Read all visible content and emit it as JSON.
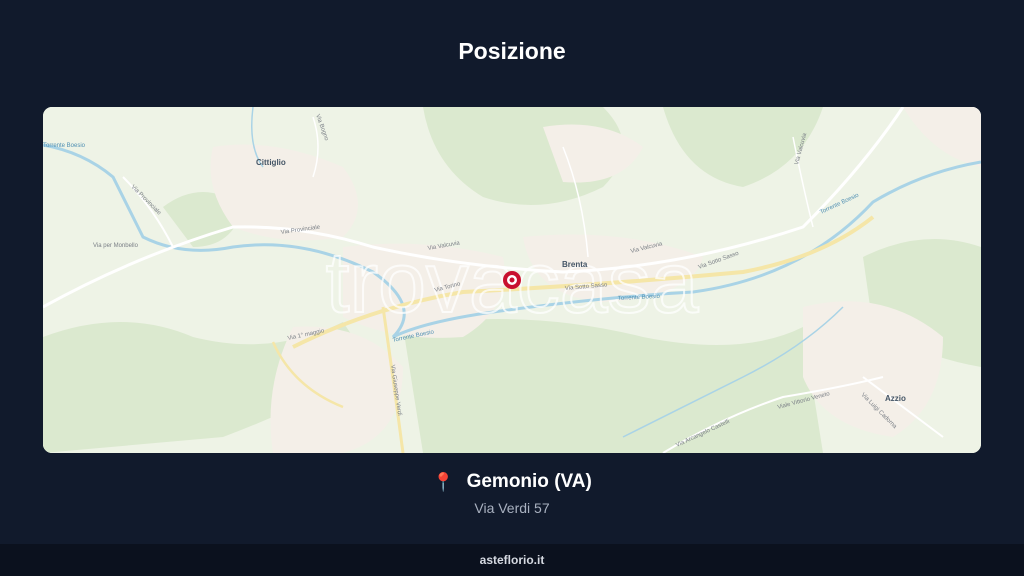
{
  "header": {
    "title": "Posizione"
  },
  "map": {
    "watermark": "trovacasa",
    "labels": {
      "cittiglio": "Cittiglio",
      "brenta": "Brenta",
      "azzio": "Azzio",
      "via_provinciale_1": "Via Provinciale",
      "via_provinciale_2": "Via Provinciale",
      "via_per_monbello": "Via per Monbello",
      "via_valcuvia_1": "Via Valcuvia",
      "via_valcuvia_2": "Via Valcuvia",
      "via_valcuvia_3": "Via Valcuvia",
      "via_torino": "Via Torino",
      "via_sotto_sasso_1": "Via Sotto Sasso",
      "via_sotto_sasso_2": "Via Sotto Sasso",
      "via_primo_maggio": "Via 1° maggio",
      "via_giuseppe_verdi": "Via Giuseppe Verdi",
      "via_arcangelo_castelli": "Via Arcangelo Castelli",
      "viale_vittorio_veneto": "Viale Vittorio Veneto",
      "via_luigi_cadorna": "Via Luigi Cadorna",
      "torrente_boesio_1": "Torrente Boesio",
      "torrente_boesio_2": "Torrente Boesio",
      "torrente_boesio_3": "Torrente Boesio",
      "torrente_boesio_4": "Torrente Boesio",
      "via_bogno": "Via Bogno",
      "via_sotto_sasso_3": "Via Sotto Sasso"
    },
    "marker": "map-pin"
  },
  "location": {
    "pin_icon": "📍",
    "city": "Gemonio (VA)",
    "address": "Via Verdi 57"
  },
  "footer": {
    "brand": "asteflorio.it"
  },
  "colors": {
    "background": "#111a2c",
    "footer": "#0b111e",
    "marker": "#c8102e",
    "river": "#a9d3e6",
    "forest": "#dbe9cf",
    "urban": "#f4efe8"
  }
}
